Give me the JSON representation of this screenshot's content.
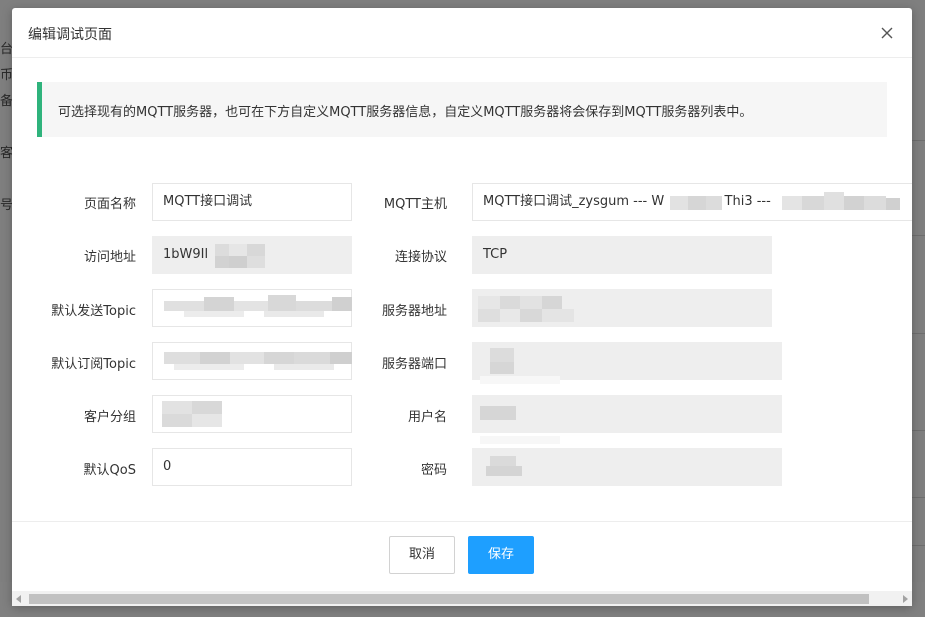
{
  "background": {
    "fragments": [
      "台",
      "币",
      "备",
      "客",
      "号"
    ]
  },
  "dialog": {
    "title": "编辑调试页面",
    "notice": "可选择现有的MQTT服务器，也可在下方自定义MQTT服务器信息，自定义MQTT服务器将会保存到MQTT服务器列表中。",
    "accent_color": "#2fb37c"
  },
  "form": {
    "page_name": {
      "label": "页面名称",
      "value": "MQTT接口调试"
    },
    "access_address": {
      "label": "访问地址",
      "value": "1bW9Il"
    },
    "default_publish_topic": {
      "label": "默认发送Topic",
      "value": ""
    },
    "default_subscribe_topic": {
      "label": "默认订阅Topic",
      "value": ""
    },
    "client_group": {
      "label": "客户分组",
      "value": ""
    },
    "default_qos": {
      "label": "默认QoS",
      "value": "0"
    },
    "mqtt_host": {
      "label": "MQTT主机",
      "value": "MQTT接口调试_zysgum --- W",
      "value_tail": "Thi3 ---"
    },
    "protocol": {
      "label": "连接协议",
      "value": "TCP"
    },
    "server_address": {
      "label": "服务器地址",
      "value": ""
    },
    "server_port": {
      "label": "服务器端口",
      "value": ""
    },
    "username": {
      "label": "用户名",
      "value": ""
    },
    "password": {
      "label": "密码",
      "value": ""
    }
  },
  "buttons": {
    "cancel": "取消",
    "save": "保存",
    "save_color": "#1e9fff"
  },
  "icons": {
    "close": "close-icon"
  }
}
